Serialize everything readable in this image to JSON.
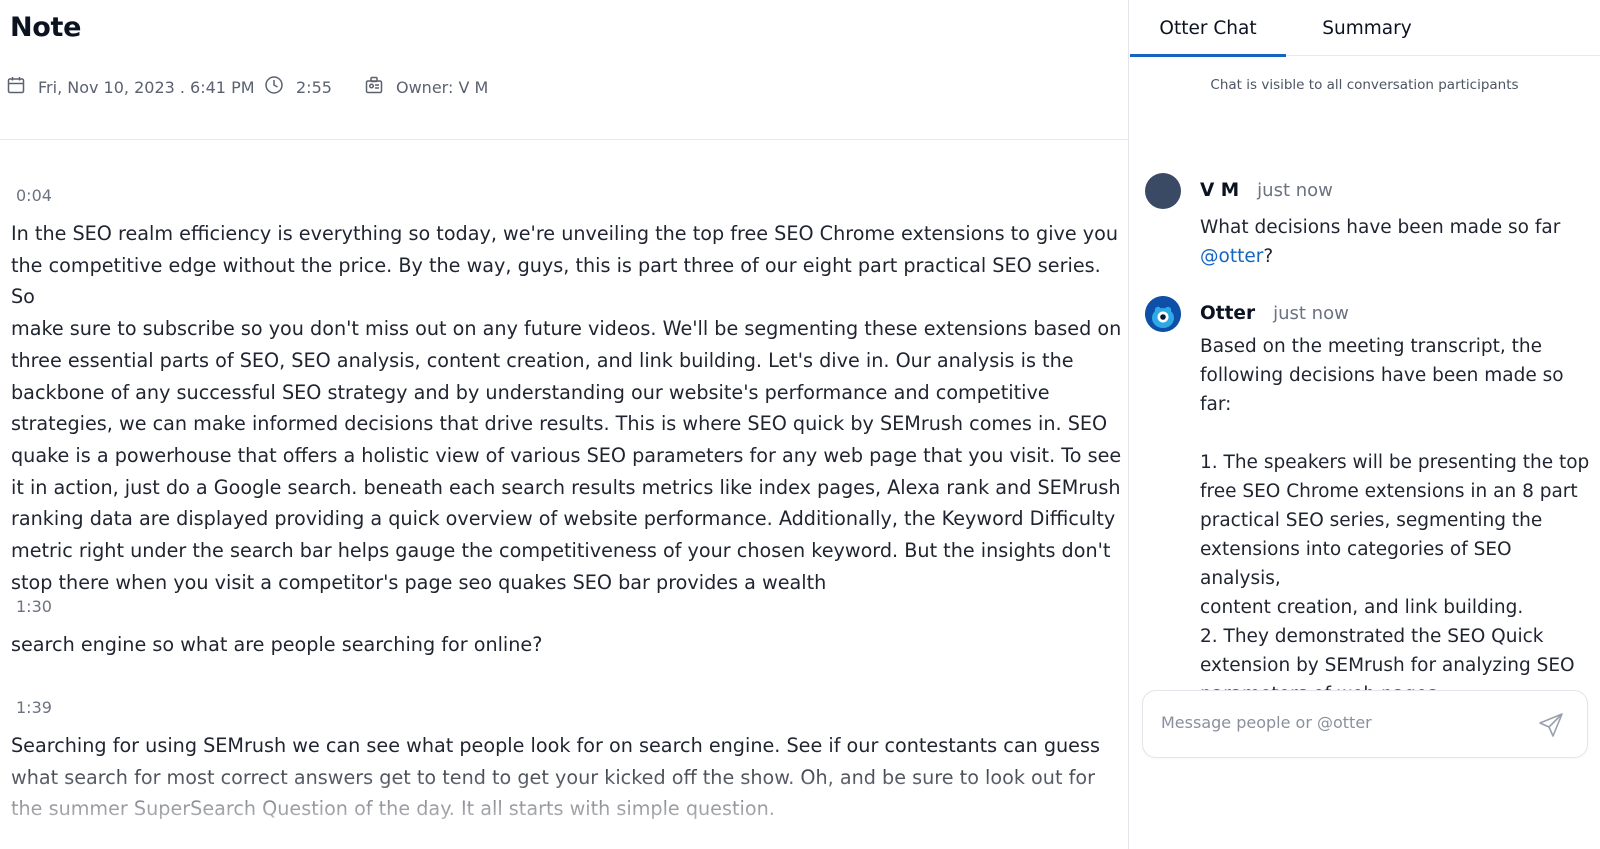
{
  "note": {
    "title": "Note",
    "date": "Fri, Nov 10, 2023 . 6:41 PM",
    "duration": "2:55",
    "owner": "Owner: V M"
  },
  "transcript": [
    {
      "time": "0:04",
      "text": "In the SEO realm efficiency is everything so today, we're unveiling the top free SEO Chrome extensions to give you\nthe competitive edge without the price. By the way, guys, this is part three of our eight part practical SEO series. So\nmake sure to subscribe so you don't miss out on any future videos. We'll be segmenting these extensions based on\nthree essential parts of SEO, SEO analysis, content creation, and link building. Let's dive in. Our analysis is the\nbackbone of any successful SEO strategy and by understanding our website's performance and competitive\nstrategies, we can make informed decisions that drive results. This is where SEO quick by SEMrush comes in. SEO\nquake is a powerhouse that offers a holistic view of various SEO parameters for any web page that you visit. To see\nit in action, just do a Google search. beneath each search results metrics like index pages, Alexa rank and SEMrush\nranking data are displayed providing a quick overview of website performance. Additionally, the Keyword Difficulty\nmetric right under the search bar helps gauge the competitiveness of your chosen keyword. But the insights don't\nstop there when you visit a competitor's page seo quakes SEO bar provides a wealth"
    },
    {
      "time": "1:30",
      "text": "search engine so what are people searching for online?"
    },
    {
      "time": "1:39",
      "text": "Searching for using SEMrush we can see what people look for on search engine. See if our contestants can guess\nwhat search for most correct answers get to tend to get your kicked off the show. Oh, and be sure to look out for\nthe summer SuperSearch Question of the day. It all starts with simple question."
    }
  ],
  "chat": {
    "tabs": [
      "Otter Chat",
      "Summary"
    ],
    "active_tab": "Otter Chat",
    "visibility_note": "Chat is visible to all conversation participants",
    "messages": [
      {
        "author": "V M",
        "time": "just now",
        "text_before": "What decisions have been made so far\n",
        "mention": "@otter",
        "text_after": "?"
      },
      {
        "author": "Otter",
        "time": "just now",
        "text": "Based on the meeting transcript, the\nfollowing decisions have been made so far:\n\n1. The speakers will be presenting the top\nfree SEO Chrome extensions in an 8 part\npractical SEO series, segmenting the\nextensions into categories of SEO analysis,\ncontent creation, and link building.\n2. They demonstrated the SEO Quick\nextension by SEMrush for analyzing SEO\nparameters of web pages."
      }
    ],
    "composer_placeholder": "Message people or @otter"
  },
  "colors": {
    "accent": "#1565c0",
    "vm_avatar": "#3a4a64",
    "otter_avatar": "#0e4fa8",
    "muted_text": "#6b7280"
  }
}
